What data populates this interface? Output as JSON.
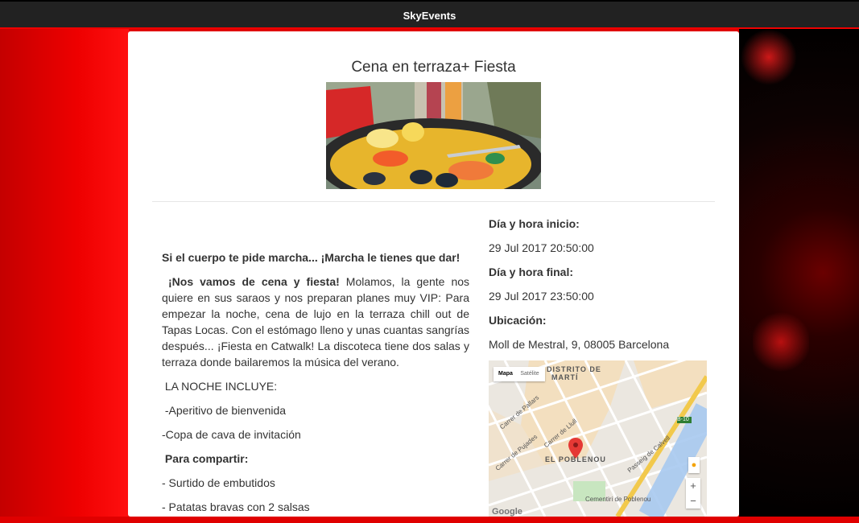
{
  "header": {
    "brand": "SkyEvents"
  },
  "event": {
    "title": "Cena en terraza+ Fiesta",
    "description": {
      "intro": "Si el cuerpo te pide marcha... ¡Marcha le tienes que dar!",
      "lead_bold": "¡Nos vamos de cena y fiesta!",
      "lead_text": " Molamos, la gente nos quiere en sus saraos y nos preparan planes muy VIP: Para empezar la noche, cena de lujo en la terraza chill out de Tapas Locas. Con el estómago lleno y unas cuantas sangrías después... ¡Fiesta en Catwalk! La discoteca tiene dos salas y terraza donde bailaremos la música del verano.",
      "includes_heading": "LA NOCHE INCLUYE:",
      "item1": "-Aperitivo de bienvenida",
      "item2": "-Copa de cava de invitación",
      "share_heading": "Para compartir:",
      "item3": "- Surtido de embutidos",
      "item4": "- Patatas bravas con 2 salsas"
    },
    "start_label": "Día y hora inicio:",
    "start_value": "29 Jul 2017 20:50:00",
    "end_label": "Día y hora final:",
    "end_value": "29 Jul 2017 23:50:00",
    "location_label": "Ubicación:",
    "location_value": "Moll de Mestral, 9, 08005 Barcelona"
  },
  "map": {
    "tab_map": "Mapa",
    "tab_satellite": "Satélite",
    "district_top": "DISTRITO DE",
    "district_top2": "MARTÍ",
    "district_main": "EL POBLENOU",
    "cemetery": "Cementiri de Poblenou",
    "street_pallars": "Carrer de Pallars",
    "street_pujades": "Carrer de Pujades",
    "street_llull": "Carrer de Llull",
    "street_calvell": "Passeig de Calvell",
    "road_b10": "B-10",
    "zoom_in": "+",
    "zoom_out": "−",
    "google": "Google"
  }
}
